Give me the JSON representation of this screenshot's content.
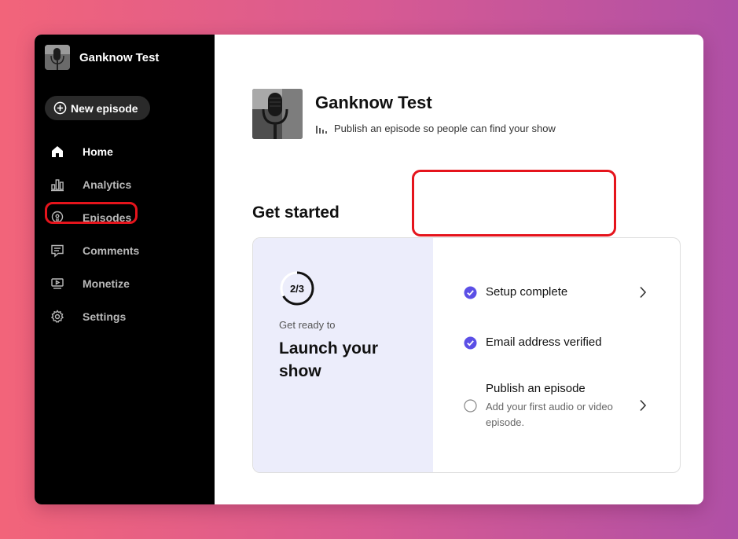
{
  "sidebar": {
    "show_name": "Ganknow Test",
    "new_episode_label": "New episode",
    "items": [
      {
        "label": "Home",
        "icon": "home-icon",
        "active": true
      },
      {
        "label": "Analytics",
        "icon": "analytics-icon",
        "active": false
      },
      {
        "label": "Episodes",
        "icon": "podcast-icon",
        "active": false
      },
      {
        "label": "Comments",
        "icon": "comment-icon",
        "active": false
      },
      {
        "label": "Monetize",
        "icon": "monetize-icon",
        "active": false
      },
      {
        "label": "Settings",
        "icon": "gear-icon",
        "active": false
      }
    ]
  },
  "header": {
    "title": "Ganknow Test",
    "subtitle": "Publish an episode so people can find your show"
  },
  "get_started": {
    "heading": "Get started",
    "progress_label": "2/3",
    "progress_completed": 2,
    "progress_total": 3,
    "ready_text": "Get ready to",
    "launch_title": "Launch your show",
    "steps": [
      {
        "title": "Setup complete",
        "description": "",
        "done": true
      },
      {
        "title": "Email address verified",
        "description": "",
        "done": true
      },
      {
        "title": "Publish an episode",
        "description": "Add your first audio or video episode.",
        "done": false
      }
    ]
  },
  "colors": {
    "accent": "#5b4fe6",
    "highlight": "#e5141c",
    "sidebar_bg": "#000000",
    "card_left_bg": "#ecedfb"
  }
}
